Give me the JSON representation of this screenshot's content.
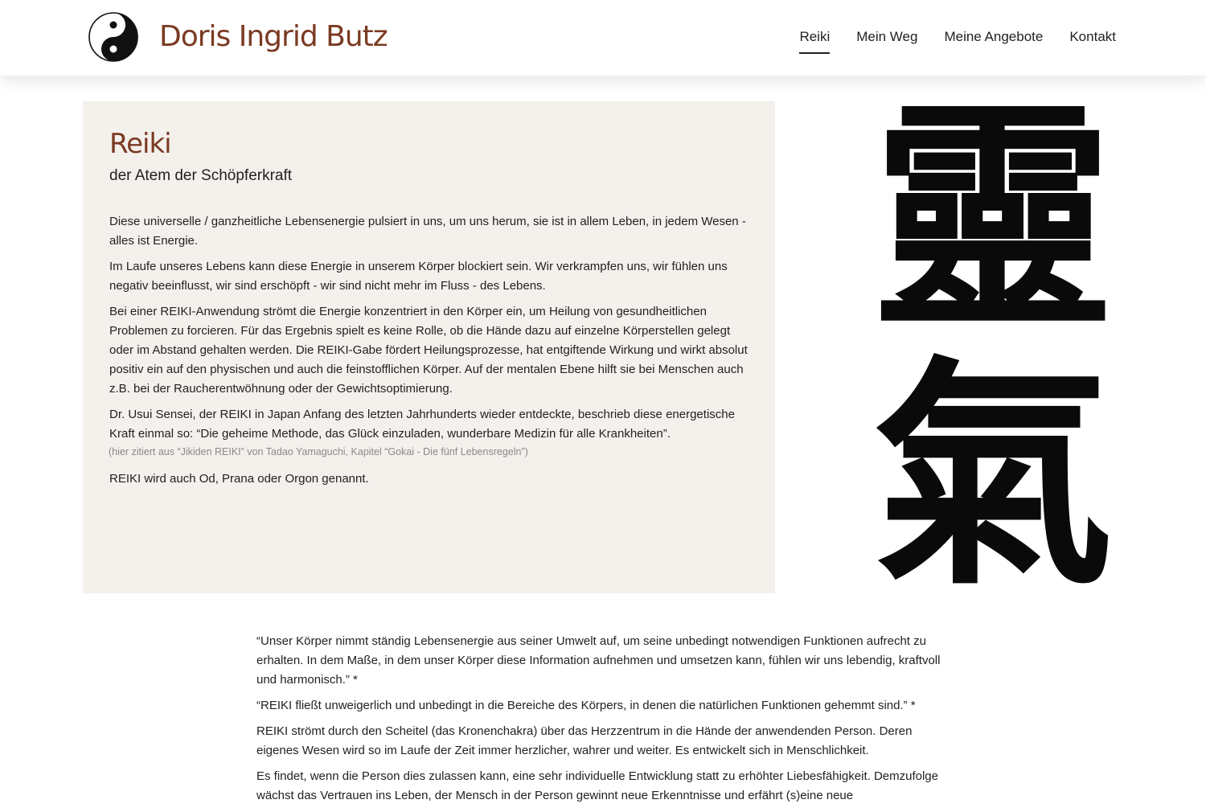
{
  "header": {
    "site_title": "Doris Ingrid Butz",
    "nav": [
      {
        "label": "Reiki",
        "active": true
      },
      {
        "label": "Mein Weg",
        "active": false
      },
      {
        "label": "Meine Angebote",
        "active": false
      },
      {
        "label": "Kontakt",
        "active": false
      }
    ],
    "logo_icon": "yin-yang-icon"
  },
  "intro": {
    "heading": "Reiki",
    "subheading": "der Atem der Schöpferkraft",
    "paragraphs": [
      "Diese universelle / ganzheitliche Lebensenergie pulsiert in uns, um uns herum, sie ist in allem Leben, in jedem Wesen - alles ist Energie.",
      "Im Laufe unseres Lebens kann diese Energie in unserem Körper blockiert sein. Wir verkrampfen uns, wir fühlen uns negativ beeinflusst, wir sind erschöpft - wir sind nicht mehr im Fluss - des Lebens.",
      "Bei einer REIKI-Anwendung strömt die Energie konzentriert in den Körper ein, um Heilung von gesundheitlichen Problemen zu forcieren. Für das Ergebnis spielt es keine Rolle, ob die Hände dazu auf einzelne Körperstellen gelegt oder im Abstand gehalten werden. Die REIKI-Gabe fördert Heilungsprozesse, hat entgiftende Wirkung und wirkt absolut positiv ein auf den physischen und auch die feinstofflichen Körper. Auf der mentalen Ebene hilft sie bei Menschen auch z.B. bei der Raucherentwöhnung oder der Gewichtsoptimierung.",
      "Dr. Usui Sensei, der REIKI in Japan Anfang des letzten Jahrhunderts wieder entdeckte, beschrieb diese energetische Kraft einmal so: “Die geheime Methode, das Glück einzuladen, wunderbare Medizin für alle Krankheiten”."
    ],
    "citation": "(hier zitiert aus “Jikiden REIKI” von Tadao Yamaguchi, Kapitel “Gokai - Die fünf Lebensregeln”)",
    "closing": "REIKI wird auch Od, Prana oder Orgon genannt."
  },
  "kanji": {
    "top": "靈",
    "bottom": "氣"
  },
  "lower": {
    "paragraphs": [
      "“Unser Körper nimmt ständig Lebensenergie aus seiner Umwelt auf, um seine unbedingt notwendigen Funktionen aufrecht zu erhalten. In dem Maße, in dem unser Körper diese Information aufnehmen und umsetzen kann, fühlen wir uns lebendig, kraftvoll und harmonisch.” *",
      "“REIKI fließt unweigerlich und unbedingt in die Bereiche des Körpers, in denen die natürlichen Funktionen gehemmt sind.” *",
      "REIKI strömt durch den Scheitel (das Kronenchakra) über das Herzzentrum in die Hände der anwendenden Person. Deren eigenes Wesen wird so im Laufe der Zeit immer herzlicher, wahrer und weiter. Es entwickelt sich in Menschlichkeit.",
      "Es findet, wenn die Person dies zulassen kann, eine sehr individuelle Entwicklung statt zu erhöhter Liebesfähigkeit. Demzufolge wächst das Vertrauen ins Leben, der Mensch in der Person gewinnt neue Erkenntnisse und erfährt (s)eine neue"
    ]
  },
  "colors": {
    "brand": "#7a3a22",
    "intro_background": "#f4f0ec",
    "citation": "#8a8a8a"
  }
}
